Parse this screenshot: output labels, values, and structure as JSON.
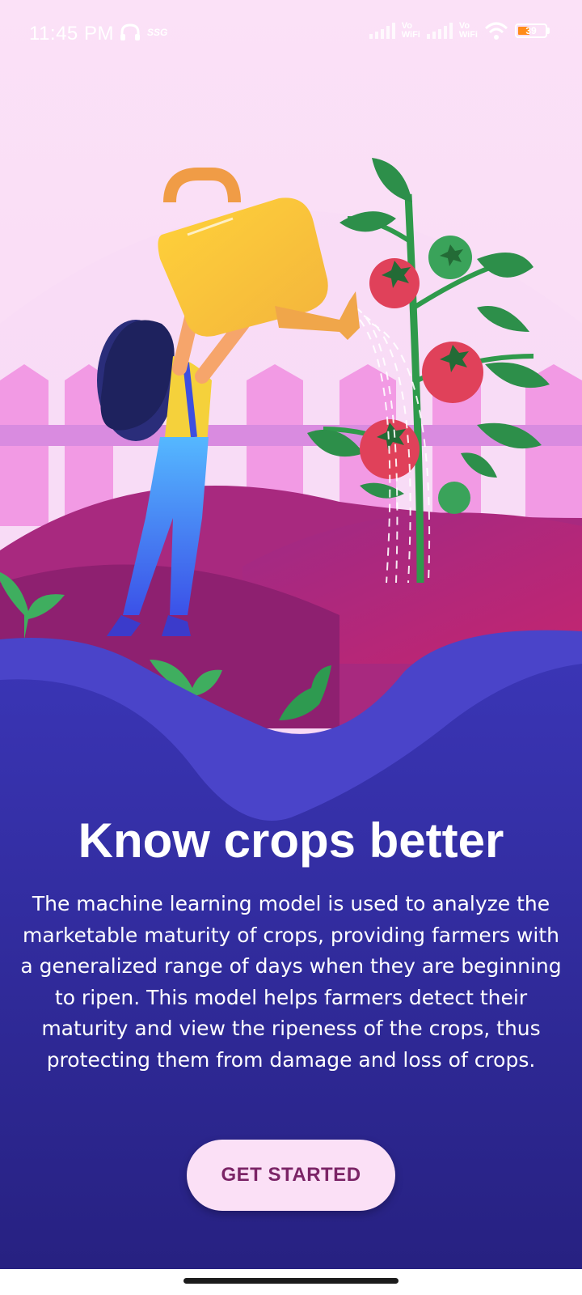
{
  "status_bar": {
    "time": "11:45 PM",
    "network_speed": "SSG",
    "vowifi_1": [
      "Vo",
      "WiFi"
    ],
    "vowifi_2": [
      "Vo",
      "WiFi"
    ],
    "battery": "39",
    "icons": [
      "headphones-icon",
      "signal-icon",
      "signal-icon",
      "wifi-icon",
      "battery-icon"
    ]
  },
  "onboarding": {
    "title": "Know crops better",
    "description": "The machine learning model is used to analyze the marketable maturity of crops, providing farmers with a generalized range of days when they are beginning to ripen. This model helps farmers detect their maturity and view the ripeness of the crops, thus protecting them from damage and loss of crops.",
    "cta_label": "GET STARTED"
  },
  "colors": {
    "background_top": "#fbe0f6",
    "panel": "#2d2a9c",
    "button_bg": "#fbe0f6",
    "button_text": "#7b2466"
  }
}
